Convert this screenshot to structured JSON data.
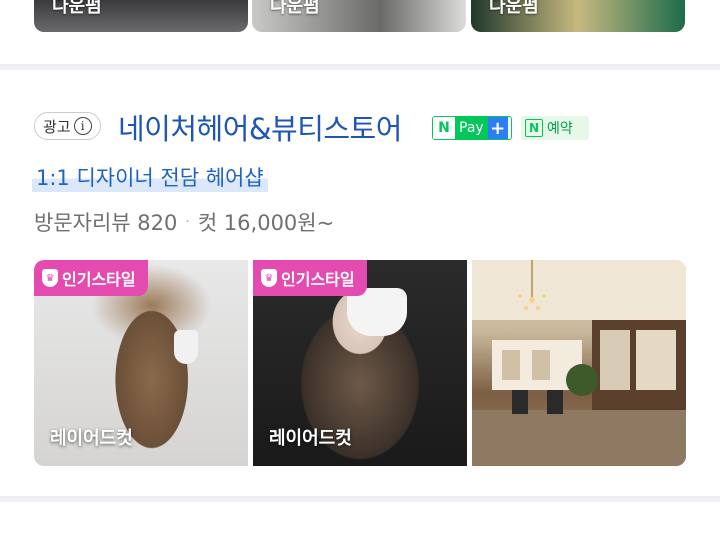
{
  "top_strip": {
    "thumbnails": [
      {
        "label": "다운펌"
      },
      {
        "label": "다운펌"
      },
      {
        "label": "다운펌"
      }
    ]
  },
  "listing": {
    "ad_label": "광고",
    "shop_name": "네이처헤어&뷰티스토어",
    "npay": {
      "logo": "N",
      "label": "Pay",
      "plus": "+"
    },
    "reserve": {
      "logo": "N",
      "label": "예약"
    },
    "tagline": "1:1 디자이너 전담 헤어샵",
    "review_label": "방문자리뷰 820",
    "price_label": "컷 16,000원~",
    "photos": [
      {
        "badge": "인기스타일",
        "caption": "레이어드컷"
      },
      {
        "badge": "인기스타일",
        "caption": "레이어드컷"
      },
      {
        "badge": "",
        "caption": ""
      }
    ]
  },
  "colors": {
    "shop_name": "#1f55b4",
    "naver_green": "#03c75a",
    "badge_pink": "#e44bb0",
    "tagline_blue": "#2063c4"
  }
}
